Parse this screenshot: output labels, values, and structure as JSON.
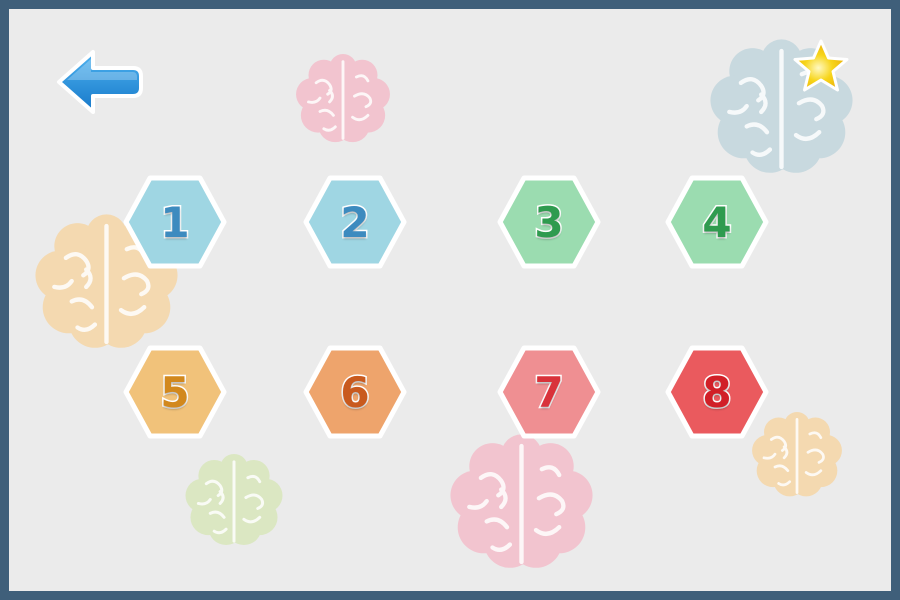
{
  "screen": {
    "background": "#ebebeb",
    "border_color": "#3f5f7a"
  },
  "nav": {
    "back_icon": "left-arrow-icon",
    "back_color": "#1e88d6",
    "star_icon": "star-icon",
    "star_color": "#f6cf14"
  },
  "levels": [
    {
      "label": "1",
      "fill": "#9fd6e3",
      "text_color": "#3d8bbf"
    },
    {
      "label": "2",
      "fill": "#9fd6e3",
      "text_color": "#3d8bbf"
    },
    {
      "label": "3",
      "fill": "#9bdcb0",
      "text_color": "#2f9b4f"
    },
    {
      "label": "4",
      "fill": "#9bdcb0",
      "text_color": "#2f9b4f"
    },
    {
      "label": "5",
      "fill": "#f1c27a",
      "text_color": "#d2881d"
    },
    {
      "label": "6",
      "fill": "#eea46c",
      "text_color": "#c95a1e"
    },
    {
      "label": "7",
      "fill": "#ef8f92",
      "text_color": "#d9323a"
    },
    {
      "label": "8",
      "fill": "#ea5a5e",
      "text_color": "#d11f27"
    }
  ],
  "decorations": {
    "brain_icon": "brain-icon",
    "brain_colors": [
      "#f2c4cf",
      "#c8d9df",
      "#f4d9b0",
      "#dbe7c2",
      "#f2c4cf",
      "#f4d9b0"
    ]
  }
}
